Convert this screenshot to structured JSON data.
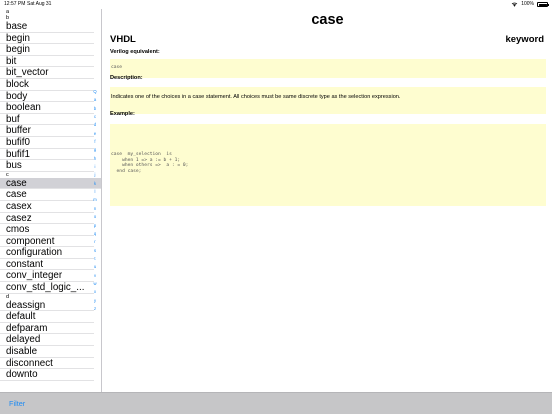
{
  "status_bar": {
    "time": "12:57 PM",
    "date": "Sat Aug 31",
    "battery": "100%"
  },
  "sidebar": {
    "rows": [
      {
        "type": "header",
        "text": "a"
      },
      {
        "type": "header",
        "text": "b"
      },
      {
        "type": "item",
        "text": "base"
      },
      {
        "type": "item",
        "text": "begin"
      },
      {
        "type": "item",
        "text": "begin"
      },
      {
        "type": "item",
        "text": "bit"
      },
      {
        "type": "item",
        "text": "bit_vector"
      },
      {
        "type": "item",
        "text": "block"
      },
      {
        "type": "item",
        "text": "body"
      },
      {
        "type": "item",
        "text": "boolean"
      },
      {
        "type": "item",
        "text": "buf"
      },
      {
        "type": "item",
        "text": "buffer"
      },
      {
        "type": "item",
        "text": "bufif0"
      },
      {
        "type": "item",
        "text": "bufif1"
      },
      {
        "type": "item",
        "text": "bus"
      },
      {
        "type": "header",
        "text": "c"
      },
      {
        "type": "item",
        "text": "case",
        "selected": true
      },
      {
        "type": "item",
        "text": "case"
      },
      {
        "type": "item",
        "text": "casex"
      },
      {
        "type": "item",
        "text": "casez"
      },
      {
        "type": "item",
        "text": "cmos"
      },
      {
        "type": "item",
        "text": "component"
      },
      {
        "type": "item",
        "text": "configuration"
      },
      {
        "type": "item",
        "text": "constant"
      },
      {
        "type": "item",
        "text": "conv_integer"
      },
      {
        "type": "item",
        "text": "conv_std_logic_..."
      },
      {
        "type": "header",
        "text": "d"
      },
      {
        "type": "item",
        "text": "deassign"
      },
      {
        "type": "item",
        "text": "default"
      },
      {
        "type": "item",
        "text": "defparam"
      },
      {
        "type": "item",
        "text": "delayed"
      },
      {
        "type": "item",
        "text": "disable"
      },
      {
        "type": "item",
        "text": "disconnect"
      },
      {
        "type": "item",
        "text": "downto"
      }
    ],
    "index_letters": [
      "Q",
      "a",
      "b",
      "c",
      "d",
      "e",
      "f",
      "g",
      "h",
      "i",
      "j",
      "k",
      "l",
      "m",
      "n",
      "o",
      "p",
      "q",
      "r",
      "s",
      "t",
      "u",
      "v",
      "w",
      "x",
      "y",
      "z"
    ]
  },
  "detail": {
    "title": "case",
    "language": "VHDL",
    "kind": "keyword",
    "verilog_label": "Verilog equivalent:",
    "verilog_value": "case",
    "description_label": "Description:",
    "description_text": "Indicates one of the choices in a case statement.  All choices must be same discrete type as the selection expression.",
    "example_label": "Example:",
    "example_code": "case  my_selection  is\n    when 1 => a := b + 1;\n    when others =>  a : = 0;\n  end case;"
  },
  "toolbar": {
    "filter_label": "Filter"
  },
  "colors": {
    "accent": "#1f8bf2",
    "code_bg": "#fefdd0",
    "selected_row": "#d1d1d6",
    "toolbar_bg": "#c6c6c8"
  }
}
